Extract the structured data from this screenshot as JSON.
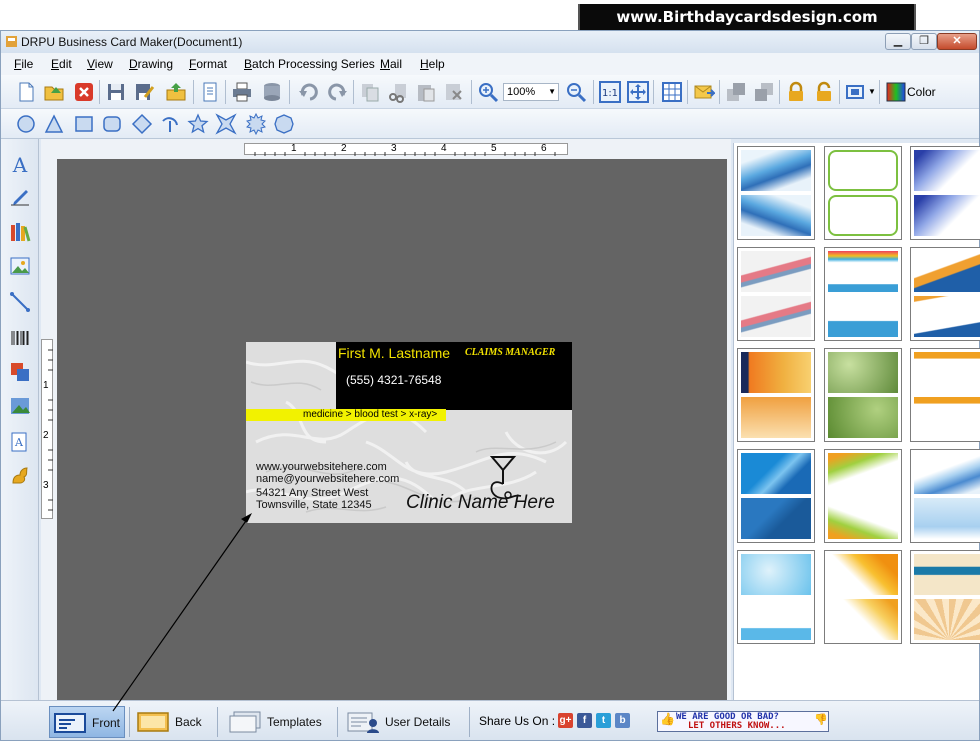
{
  "banner": {
    "text": "www.Birthdaycardsdesign.com"
  },
  "window": {
    "title": "DRPU Business Card Maker(Document1)"
  },
  "menu": [
    {
      "mnemonic": "F",
      "rest": "ile"
    },
    {
      "mnemonic": "E",
      "rest": "dit"
    },
    {
      "mnemonic": "V",
      "rest": "iew"
    },
    {
      "mnemonic": "D",
      "rest": "rawing"
    },
    {
      "mnemonic": "F",
      "rest": "ormat"
    },
    {
      "mnemonic": "B",
      "rest": "atch Processing Series"
    },
    {
      "mnemonic": "M",
      "rest": "ail"
    },
    {
      "mnemonic": "H",
      "rest": "elp"
    }
  ],
  "toolbar": {
    "zoom": "100%",
    "color_label": "Color"
  },
  "ruler": {
    "h_ticks": [
      "1",
      "2",
      "3",
      "4",
      "5",
      "6"
    ],
    "v_ticks": [
      "1",
      "2",
      "3"
    ]
  },
  "card": {
    "name": "First M. Lastname",
    "role": "CLAIMS MANAGER",
    "phone": "(555) 4321-76548",
    "tagline": "medicine > blood test > x-ray>",
    "website": "www.yourwebsitehere.com",
    "email": "name@yourwebsitehere.com",
    "street": "54321 Any Street West",
    "city": "Townsville, State 12345",
    "clinic": "Clinic Name Here"
  },
  "bottom_tabs": {
    "front": "Front",
    "back": "Back",
    "templates": "Templates",
    "user_details": "User Details"
  },
  "share": {
    "label": "Share Us On :",
    "networks": [
      "g+",
      "f",
      "t",
      "b"
    ]
  },
  "feedback": {
    "line1": "WE ARE GOOD OR BAD?",
    "line2": "LET OTHERS KNOW..."
  },
  "colors": {
    "accent": "#3a6fc4",
    "card_yellow": "#f2f200",
    "canvas": "#646464"
  }
}
